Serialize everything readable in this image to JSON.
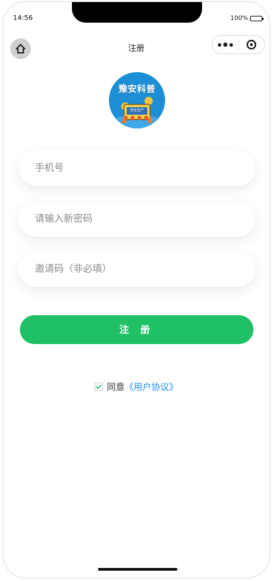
{
  "status": {
    "time": "14:56",
    "battery": "100%"
  },
  "nav": {
    "title": "注册"
  },
  "logo": {
    "text": "豫安科普",
    "sign_text": "安全生产"
  },
  "form": {
    "phone_placeholder": "手机号",
    "password_placeholder": "请输入新密码",
    "invite_placeholder": "邀请码（非必填）"
  },
  "register": {
    "label": "注 册"
  },
  "agreement": {
    "prefix": "同意",
    "link": "《用户协议》",
    "checked": true
  },
  "colors": {
    "primary": "#20c065",
    "link": "#1a8cff",
    "logo_bg": "#1d8fd6"
  }
}
